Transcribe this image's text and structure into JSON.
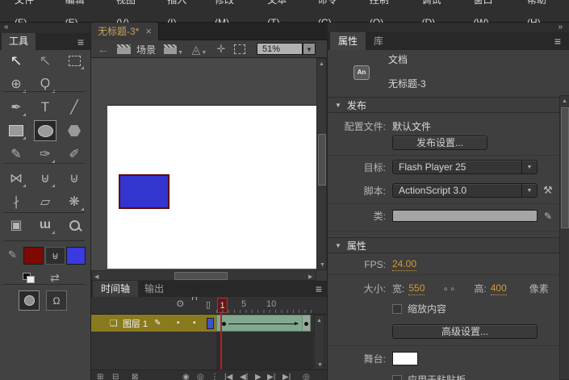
{
  "colors": {
    "accent_orange": "#d09a3e",
    "tween_green": "#82a98e",
    "layer_selected_olive": "#8a7a1e",
    "fill_blue": "#3434cf",
    "stroke_dark_red": "#70100e",
    "stage_white": "#ffffff",
    "playhead_red": "#b42025"
  },
  "menu": {
    "items": [
      "文件(F)",
      "编辑(E)",
      "视图(V)",
      "插入(I)",
      "修改(M)",
      "文本(T)",
      "命令(C)",
      "控制(O)",
      "调试(D)",
      "窗口(W)",
      "帮助(H)"
    ]
  },
  "tools": {
    "title": "工具"
  },
  "doc": {
    "tab_title": "无标题-3*",
    "close": "×",
    "scene_label": "场景",
    "zoom_value": "51%"
  },
  "timeline": {
    "tab_timeline": "时间轴",
    "tab_output": "输出",
    "layer_name": "图层 1",
    "frame_1": "1",
    "frame_5": "5",
    "frame_10": "10"
  },
  "props": {
    "tab_properties": "属性",
    "tab_library": "库",
    "an_badge": "An",
    "doc_type": "文档",
    "doc_name": "无标题-3",
    "publish_header": "发布",
    "profile_label": "配置文件:",
    "profile_value": "默认文件",
    "publish_settings": "发布设置...",
    "target_label": "目标:",
    "target_value": "Flash Player 25",
    "script_label": "脚本:",
    "script_value": "ActionScript 3.0",
    "class_label": "类:",
    "properties_header": "属性",
    "fps_label": "FPS:",
    "fps_value": "24.00",
    "size_label": "大小:",
    "width_label": "宽:",
    "width_value": "550",
    "height_label": "高:",
    "height_value": "400",
    "unit_label": "像素",
    "scale_label": "缩放内容",
    "advanced_settings": "高级设置...",
    "stage_label": "舞台:",
    "apply_label": "应用于粘贴板"
  },
  "icons": {
    "collapse": "«",
    "expand": "»",
    "back": "←",
    "hamburger": "≡",
    "selection": "↖",
    "subselection": "↖",
    "rotate3d": "⊕",
    "lasso": "Ϙ",
    "pen": "✒",
    "text": "T",
    "line": "╱",
    "pencil": "✎",
    "brush": "✑",
    "paintbrush": "✐",
    "bone": "⋈",
    "bucket": "⊎",
    "ink": "⊍",
    "eyedropper": "∤",
    "eraser": "▱",
    "deco": "❋",
    "camera": "▣",
    "hand": "ɯ",
    "swap": "⇄",
    "magnet": "Ω",
    "symbols": "◬",
    "center_frame": "✛",
    "eye": "ʘ",
    "outline": "▯",
    "layer_page": "❏",
    "layer_pencil": "✎",
    "dot": "•",
    "wrench": "⚒",
    "field_pencil": "✎",
    "link_broken": "∘∘",
    "tri_down": "▼",
    "tri_up": "▲",
    "tri_left": "◀",
    "tri_right": "▶",
    "tl_new_layer": "⊞",
    "tl_folder": "⊟",
    "tl_delete": "⊠",
    "tl_onion": "◉",
    "tl_onion_outline": "◎",
    "tl_center": "⋮",
    "pb_first": "|◀",
    "pb_prev": "◀|",
    "pb_play": "▶",
    "pb_next": "▶|",
    "pb_last": "▶|"
  }
}
